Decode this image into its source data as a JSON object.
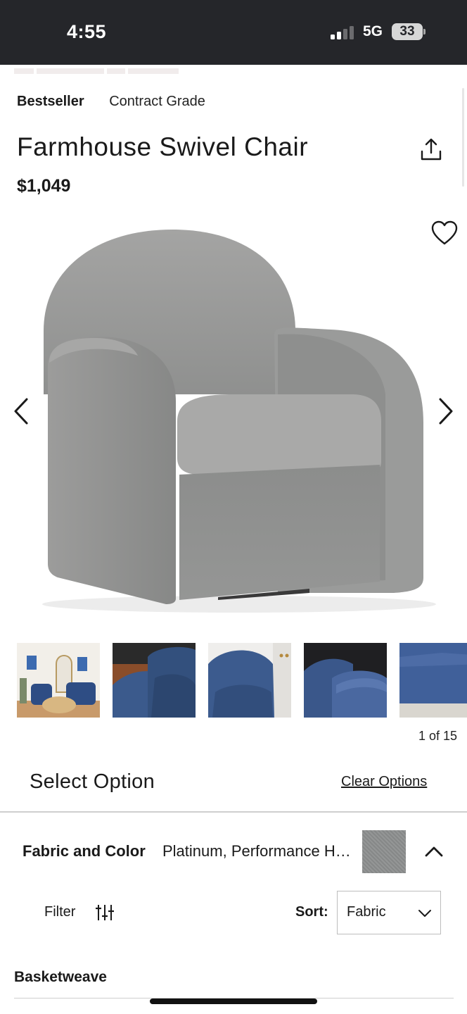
{
  "status_bar": {
    "time": "4:55",
    "network": "5G",
    "battery": "33"
  },
  "product": {
    "tags": [
      "Bestseller",
      "Contract Grade"
    ],
    "title": "Farmhouse Swivel Chair",
    "price": "$1,049",
    "fabric_color_hex": "#8d8f8f"
  },
  "gallery": {
    "counter": "1 of 15",
    "thumbnail_count": 5
  },
  "options": {
    "heading": "Select Option",
    "clear_label": "Clear Options",
    "fabric": {
      "label": "Fabric and Color",
      "value": "Platinum, Performance Heathered Tweed"
    },
    "filter_label": "Filter",
    "sort": {
      "label": "Sort:",
      "value": "Fabric"
    },
    "section_heading": "Basketweave"
  },
  "icons": [
    "share-icon",
    "heart-icon",
    "chevron-left-icon",
    "chevron-right-icon",
    "chevron-up-icon",
    "filter-sliders-icon",
    "chevron-down-icon"
  ]
}
